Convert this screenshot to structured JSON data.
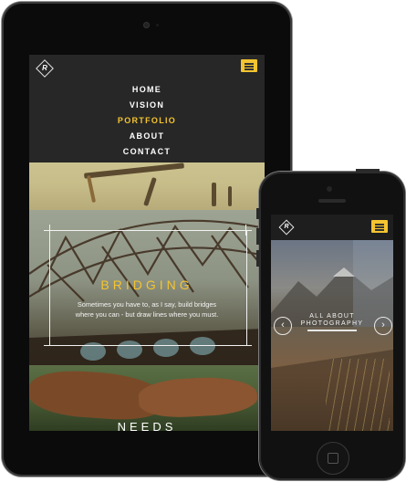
{
  "tablet": {
    "logo_text": "R",
    "nav": [
      "HOME",
      "VISION",
      "PORTFOLIO",
      "ABOUT",
      "CONTACT"
    ],
    "active_nav_index": 2,
    "sections": {
      "bridging_title": "BRIDGING",
      "bridging_text": "Sometimes you have to, as I say, build bridges where you can - but draw lines where you must.",
      "needs_title": "NEEDS"
    }
  },
  "phone": {
    "logo_text": "R",
    "slide_title": "ALL ABOUT PHOTOGRAPHY",
    "prev_arrow": "‹",
    "next_arrow": "›"
  },
  "colors": {
    "accent": "#f4c430",
    "header_bg": "#272727"
  },
  "icons": {
    "menu": "hamburger-icon",
    "logo": "diamond-logo-icon",
    "prev": "chevron-left-icon",
    "next": "chevron-right-icon"
  }
}
